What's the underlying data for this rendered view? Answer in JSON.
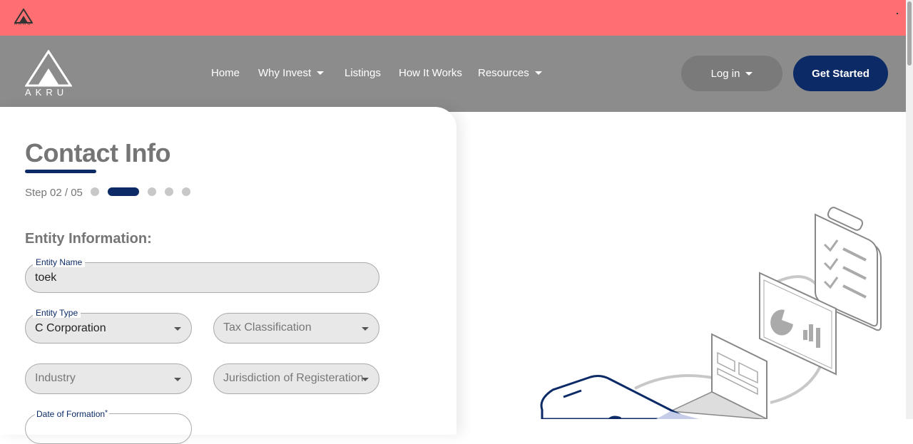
{
  "alert": {
    "logo_text": "AKRU"
  },
  "header": {
    "logo_text": "AKRU",
    "nav": [
      {
        "label": "Home",
        "dropdown": false
      },
      {
        "label": "Why Invest",
        "dropdown": true
      },
      {
        "label": "Listings",
        "dropdown": false
      },
      {
        "label": "How It Works",
        "dropdown": false
      },
      {
        "label": "Resources",
        "dropdown": true
      }
    ],
    "login_label": "Log in",
    "get_started_label": "Get Started"
  },
  "form": {
    "title": "Contact Info",
    "step_text": "Step 02 / 05",
    "step_current": 2,
    "step_total": 5,
    "section_title": "Entity Information:",
    "entity_name": {
      "label": "Entity Name",
      "value": "toek"
    },
    "entity_type": {
      "label": "Entity Type",
      "value": "C Corporation"
    },
    "tax_classification": {
      "placeholder": "Tax Classification"
    },
    "industry": {
      "placeholder": "Industry"
    },
    "jurisdiction": {
      "placeholder": "Jurisdiction of Registeration"
    },
    "date_of_formation": {
      "label": "Date of Formation",
      "required_mark": "*"
    }
  },
  "colors": {
    "alert_bg": "#ff6f72",
    "header_bg": "#8c8c8c",
    "brand_navy": "#0b2a66"
  }
}
